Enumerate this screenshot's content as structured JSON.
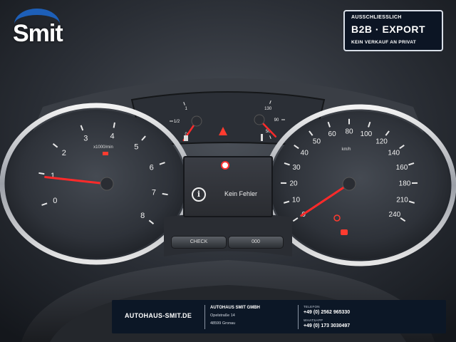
{
  "logo": {
    "text": "Smit"
  },
  "badge": {
    "line1": "AUSSCHLIESSLICH",
    "line2": "B2B  ·  EXPORT",
    "line3": "KEIN VERKAUF AN PRIVAT"
  },
  "tachometer": {
    "ticks": [
      "0",
      "1",
      "2",
      "3",
      "4",
      "5",
      "6",
      "7",
      "8"
    ],
    "unit": "x1000/min",
    "needle_value": 0.9
  },
  "speedometer": {
    "ticks": [
      "0",
      "10",
      "20",
      "30",
      "40",
      "50",
      "60",
      "80",
      "100",
      "120",
      "140",
      "160",
      "180",
      "210",
      "240"
    ],
    "unit": "km/h",
    "needle_value": 0
  },
  "fuel_gauge": {
    "ticks": [
      "0",
      "1/2",
      "1"
    ]
  },
  "temp_gauge": {
    "ticks": [
      "50",
      "90",
      "130"
    ]
  },
  "display": {
    "message": "Kein Fehler"
  },
  "buttons": {
    "check": "CHECK",
    "odo": "000"
  },
  "footer": {
    "website": "AUTOHAUS-SMIT.DE",
    "company": "AUTOHAUS SMIT GMBH",
    "street": "Opelstraße 14",
    "city": "48599 Gronau",
    "phone_label": "TELEFON",
    "phone": "+49 (0) 2562 965330",
    "whatsapp_label": "WHATSAPP",
    "whatsapp": "+49 (0) 173 3030497"
  },
  "colors": {
    "needle": "#ff2a2a",
    "brand_blue": "#1d5fb8",
    "footer_bg": "#0c1726"
  }
}
